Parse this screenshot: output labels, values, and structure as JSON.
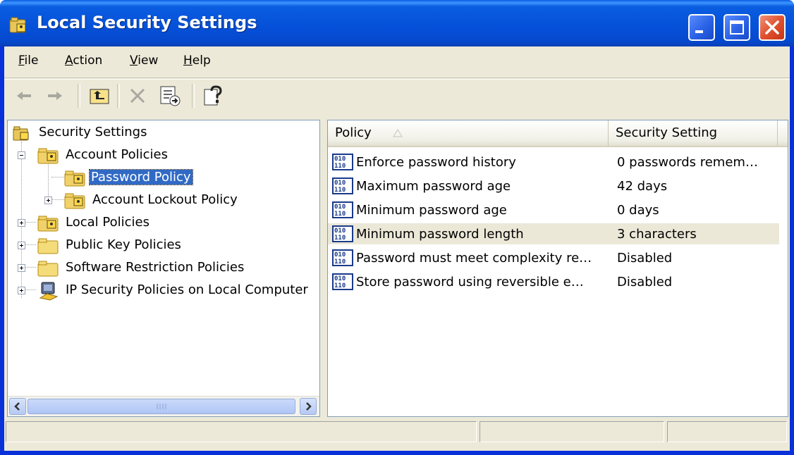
{
  "window": {
    "title": "Local Security Settings",
    "icon": "security-settings-icon",
    "controls": [
      "minimize-icon",
      "maximize-icon",
      "close-icon"
    ]
  },
  "menu": [
    {
      "label": "File",
      "accel": "F",
      "rest": "ile"
    },
    {
      "label": "Action",
      "accel": "A",
      "rest": "ction"
    },
    {
      "label": "View",
      "accel": "V",
      "rest": "iew"
    },
    {
      "label": "Help",
      "accel": "H",
      "rest": "elp"
    }
  ],
  "toolbar": {
    "buttons": [
      "back-arrow-icon",
      "forward-arrow-icon",
      "up-folder-icon",
      "delete-x-icon",
      "export-list-icon",
      "help-icon"
    ]
  },
  "tree": {
    "root": "Security Settings",
    "nodes": [
      {
        "label": "Account Policies",
        "level": 1,
        "expanded": true
      },
      {
        "label": "Password Policy",
        "level": 2,
        "selected": true
      },
      {
        "label": "Account Lockout Policy",
        "level": 2,
        "expanded": false
      },
      {
        "label": "Local Policies",
        "level": 1,
        "expanded": false
      },
      {
        "label": "Public Key Policies",
        "level": 1,
        "expanded": false
      },
      {
        "label": "Software Restriction Policies",
        "level": 1,
        "expanded": false
      },
      {
        "label": "IP Security Policies on Local Computer",
        "level": 1,
        "expanded": false
      }
    ]
  },
  "list": {
    "columns": {
      "policy": "Policy",
      "setting": "Security Setting"
    },
    "sort_column": "Policy",
    "rows": [
      {
        "policy": "Enforce password history",
        "setting": "0 passwords remem…"
      },
      {
        "policy": "Maximum password age",
        "setting": "42 days"
      },
      {
        "policy": "Minimum password age",
        "setting": "0 days"
      },
      {
        "policy": "Minimum password length",
        "setting": "3 characters",
        "highlighted": true
      },
      {
        "policy": "Password must meet complexity re…",
        "setting": "Disabled"
      },
      {
        "policy": "Store password using reversible e…",
        "setting": "Disabled"
      }
    ]
  },
  "colors": {
    "titlebar": "#0a5de0",
    "selection": "#316ac5",
    "chrome": "#ece9d8",
    "close": "#e0522f"
  }
}
